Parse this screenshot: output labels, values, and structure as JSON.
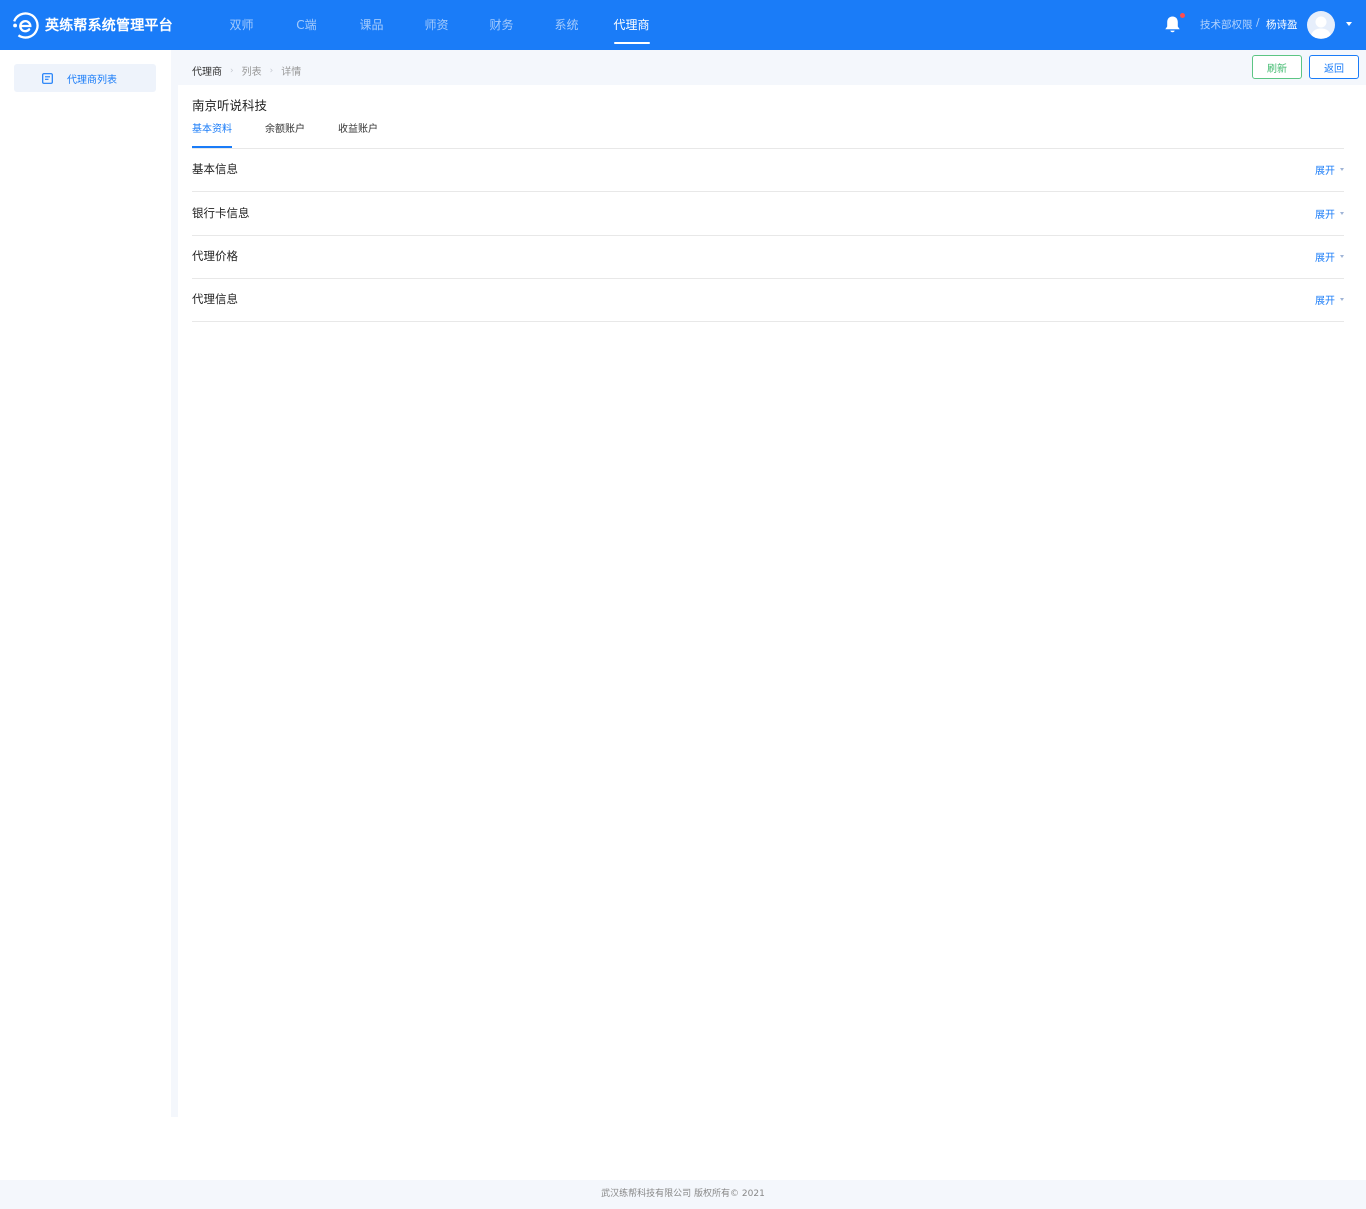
{
  "header": {
    "app_title": "英练帮系统管理平台",
    "nav": [
      {
        "label": "双师",
        "active": false
      },
      {
        "label": "C端",
        "active": false
      },
      {
        "label": "课品",
        "active": false
      },
      {
        "label": "师资",
        "active": false
      },
      {
        "label": "财务",
        "active": false
      },
      {
        "label": "系统",
        "active": false
      },
      {
        "label": "代理商",
        "active": true
      }
    ],
    "role": "技术部权限",
    "separator": "/",
    "username": "杨诗盈",
    "has_notification": true
  },
  "sidebar": {
    "items": [
      {
        "label": "代理商列表",
        "icon": "list-doc-icon",
        "active": true
      }
    ]
  },
  "breadcrumb": [
    "代理商",
    "列表",
    "详情"
  ],
  "actions": {
    "refresh_label": "刷新",
    "back_label": "返回"
  },
  "detail": {
    "company_name": "南京听说科技",
    "tabs": [
      {
        "label": "基本资料",
        "active": true
      },
      {
        "label": "余额账户",
        "active": false
      },
      {
        "label": "收益账户",
        "active": false
      }
    ],
    "sections": [
      {
        "title": "基本信息",
        "toggle_label": "展开"
      },
      {
        "title": "银行卡信息",
        "toggle_label": "展开"
      },
      {
        "title": "代理价格",
        "toggle_label": "展开"
      },
      {
        "title": "代理信息",
        "toggle_label": "展开"
      }
    ]
  },
  "footer": {
    "copyright": "武汉练帮科技有限公司 版权所有© 2021"
  },
  "colors": {
    "primary": "#1a7cf8",
    "success": "#3fba6e",
    "page_bg": "#f4f7fc"
  }
}
